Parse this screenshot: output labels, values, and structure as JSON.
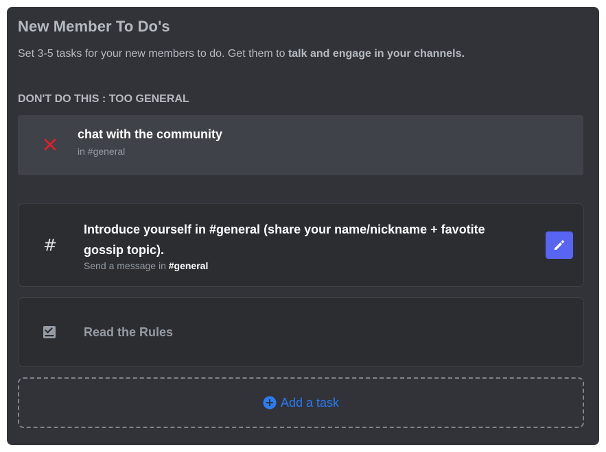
{
  "header": {
    "title": "New Member To Do's",
    "subtitle_plain": "Set 3-5 tasks for your new members to do. Get them to ",
    "subtitle_bold": "talk and engage in your channels."
  },
  "example": {
    "section_label": "DON'T DO THIS : TOO GENERAL",
    "task_title": "chat with the community",
    "task_channel": "in #general",
    "icon": "close-icon",
    "icon_color": "#ed1c24"
  },
  "tasks": [
    {
      "title": "Introduce yourself in #general (share your name/nickname + favotite gossip topic).",
      "sub_prefix": "Send a message in ",
      "sub_channel": "#general",
      "icon": "hash-icon",
      "icon_glyph": "#",
      "action": "edit-icon"
    },
    {
      "title": "Read the Rules",
      "icon": "rules-icon"
    }
  ],
  "add_task": {
    "label": "Add a task",
    "icon": "plus-circle-icon"
  },
  "colors": {
    "panel_bg": "#313338",
    "card_bg": "#2b2d31",
    "accent": "#5865f2",
    "link": "#2b7bf5"
  }
}
